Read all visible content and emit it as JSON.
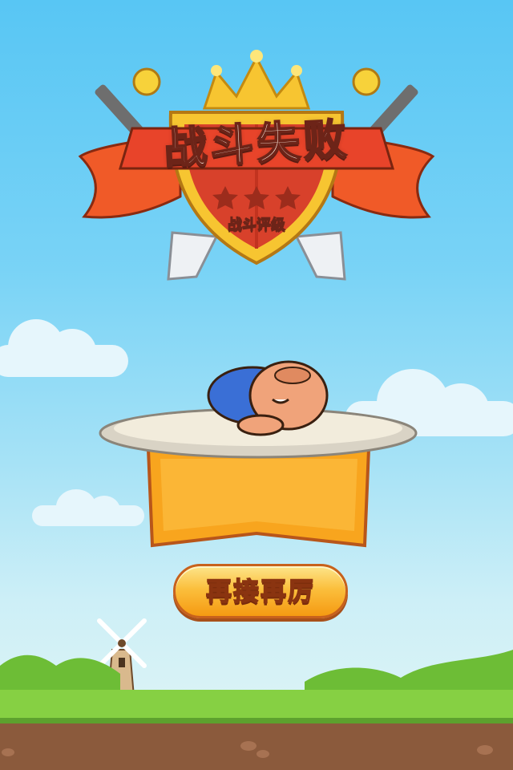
{
  "screen": {
    "title": "战斗失败",
    "rating_label": "战斗评级",
    "stars_earned": 0,
    "stars_total": 3
  },
  "actions": {
    "retry_label": "再接再厉"
  },
  "colors": {
    "sky_top": "#58c6f4",
    "shield_red": "#d8412b",
    "gold": "#f7c531",
    "button_orange": "#f59a12",
    "grass": "#7cc63a",
    "soil": "#8b5a3c"
  }
}
